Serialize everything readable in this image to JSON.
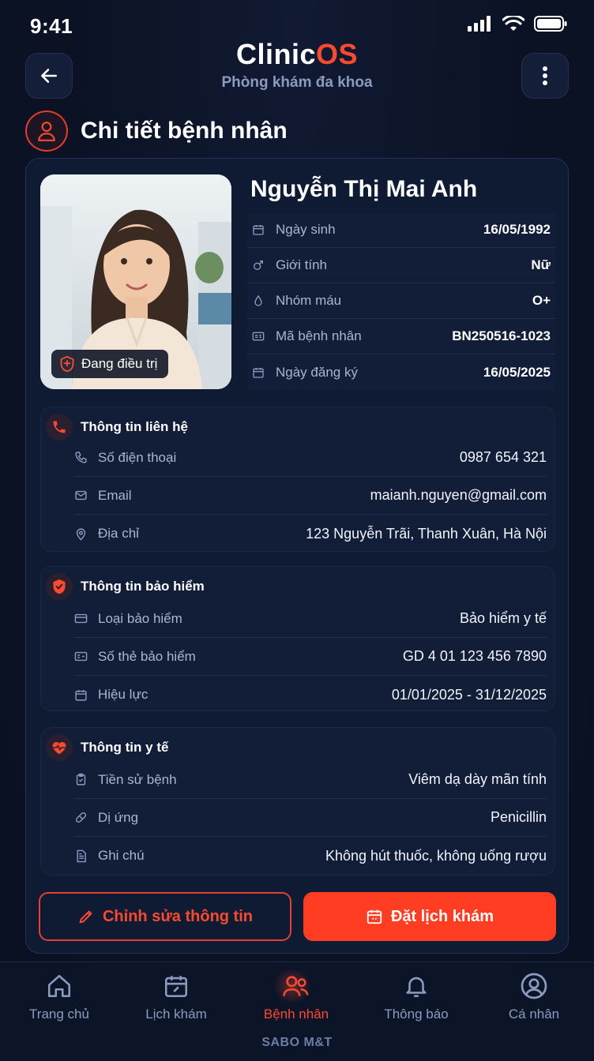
{
  "status_bar": {
    "time": "9:41"
  },
  "header": {
    "brand_prefix": "Clinic",
    "brand_accent": "OS",
    "subtitle": "Phòng khám đa khoa"
  },
  "page": {
    "title": "Chi tiết bệnh nhân"
  },
  "patient": {
    "name": "Nguyễn Thị Mai Anh",
    "status_badge": "Đang điều trị",
    "info": [
      {
        "icon": "calendar-icon",
        "label": "Ngày sinh",
        "value": "16/05/1992"
      },
      {
        "icon": "gender-icon",
        "label": "Giới tính",
        "value": "Nữ"
      },
      {
        "icon": "blood-drop-icon",
        "label": "Nhóm máu",
        "value": "O+"
      },
      {
        "icon": "id-card-icon",
        "label": "Mã bệnh nhân",
        "value": "BN250516-1023"
      },
      {
        "icon": "calendar-icon",
        "label": "Ngày đăng ký",
        "value": "16/05/2025"
      }
    ]
  },
  "contact": {
    "title": "Thông tin liên hệ",
    "rows": [
      {
        "icon": "phone-icon",
        "label": "Số điện thoại",
        "value": "0987 654 321"
      },
      {
        "icon": "mail-icon",
        "label": "Email",
        "value": "maianh.nguyen@gmail.com"
      },
      {
        "icon": "map-pin-icon",
        "label": "Địa chỉ",
        "value": "123 Nguyễn Trãi, Thanh Xuân, Hà Nội"
      }
    ]
  },
  "insurance": {
    "title": "Thông tin bảo hiểm",
    "rows": [
      {
        "icon": "card-icon",
        "label": "Loại bảo hiểm",
        "value": "Bảo hiểm y tế"
      },
      {
        "icon": "id-card-icon",
        "label": "Số thẻ bảo hiểm",
        "value": "GD 4 01 123 456 7890"
      },
      {
        "icon": "calendar-icon",
        "label": "Hiệu lực",
        "value": "01/01/2025 - 31/12/2025"
      }
    ]
  },
  "medical": {
    "title": "Thông tin y tế",
    "rows": [
      {
        "icon": "clipboard-icon",
        "label": "Tiền sử bệnh",
        "value": "Viêm dạ dày mãn tính"
      },
      {
        "icon": "pill-icon",
        "label": "Dị ứng",
        "value": "Penicillin"
      },
      {
        "icon": "document-icon",
        "label": "Ghi chú",
        "value": "Không hút thuốc, không uống rượu"
      }
    ]
  },
  "actions": {
    "edit_label": "Chỉnh sửa thông tin",
    "book_label": "Đặt lịch khám"
  },
  "nav": {
    "items": [
      {
        "icon": "home-icon",
        "label": "Trang chủ"
      },
      {
        "icon": "calendar-edit-icon",
        "label": "Lịch khám"
      },
      {
        "icon": "users-icon",
        "label": "Bệnh nhân"
      },
      {
        "icon": "bell-icon",
        "label": "Thông báo"
      },
      {
        "icon": "user-circle-icon",
        "label": "Cá nhân"
      }
    ],
    "active_index": 2
  },
  "footer": {
    "text": "SABO M&T"
  },
  "colors": {
    "accent": "#ff4a2f",
    "background": "#0b1224",
    "card": "#0f1a33",
    "muted_text": "#aab6d0"
  }
}
